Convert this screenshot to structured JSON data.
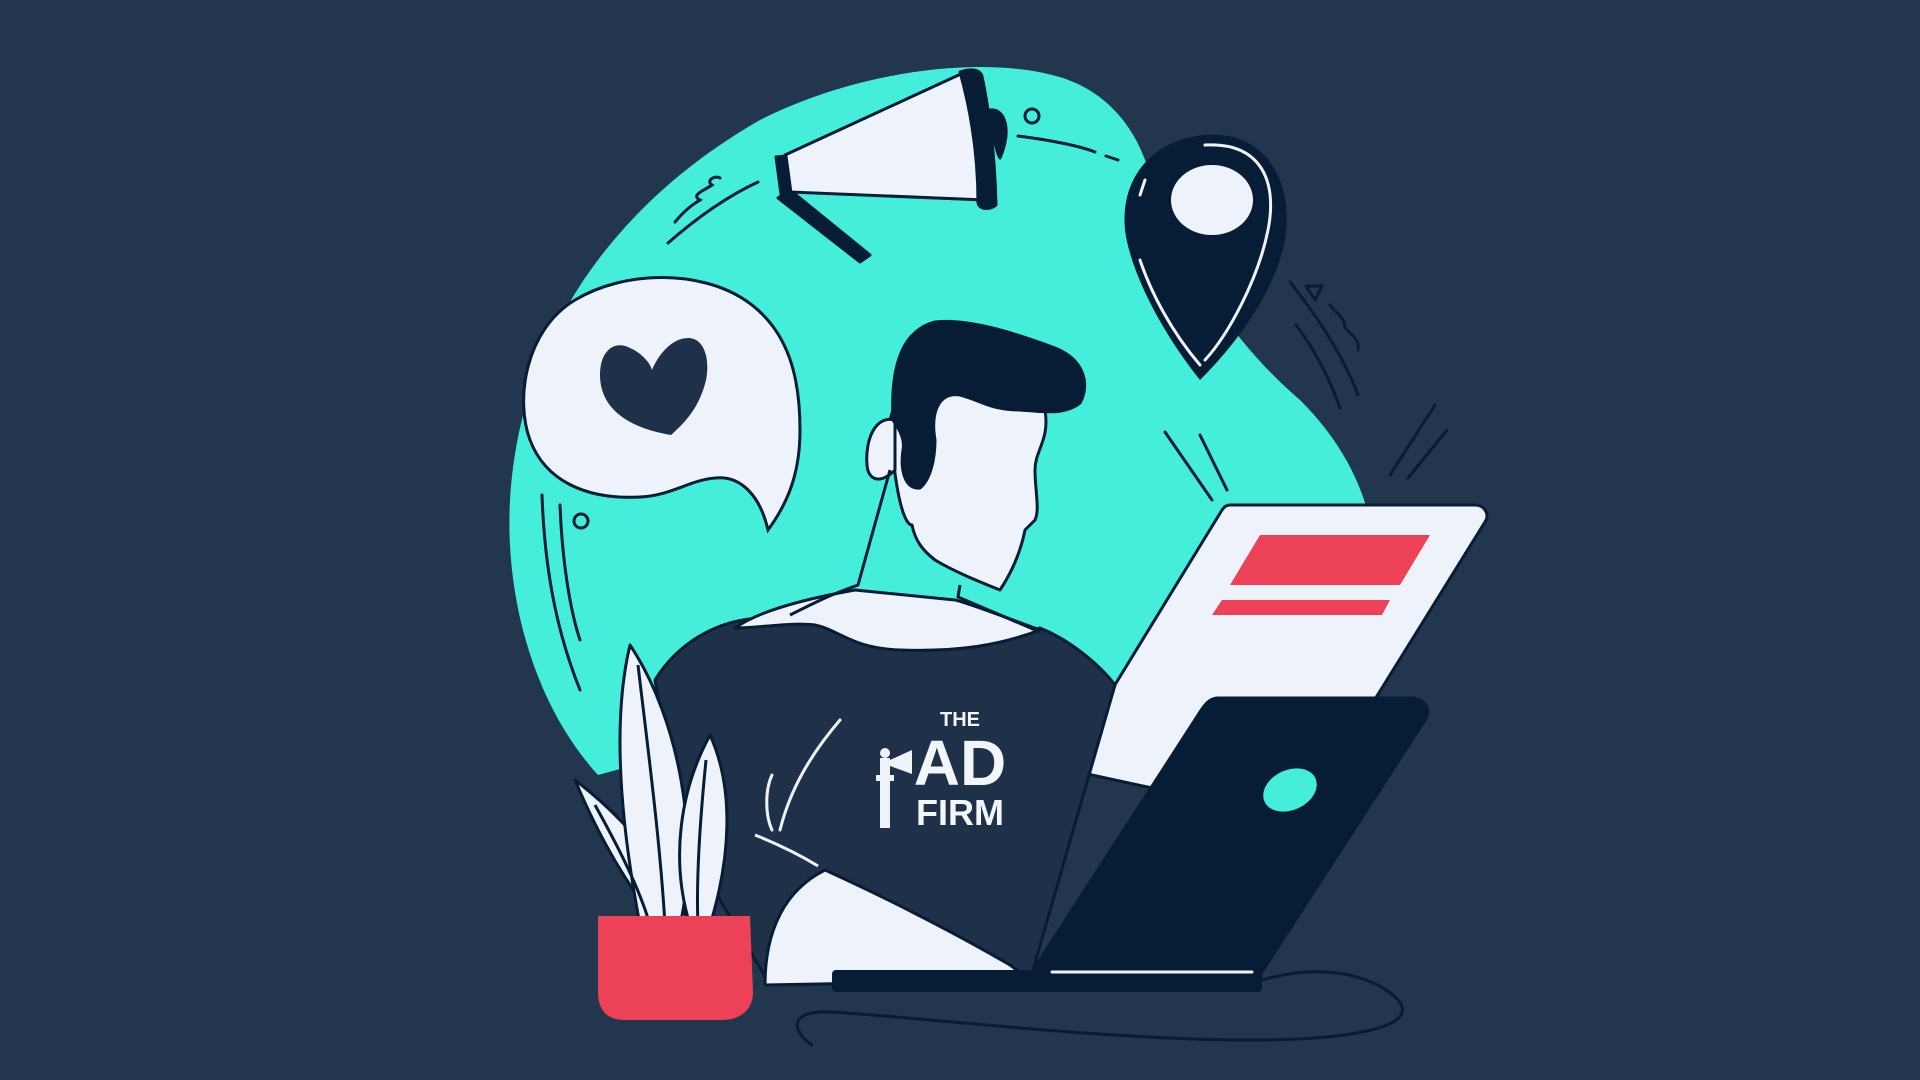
{
  "colors": {
    "background": "#22374d",
    "blob": "#44eedb",
    "navy": "#061d35",
    "shirt": "#1f3148",
    "white": "#eef3fb",
    "accent_red": "#ec4157"
  },
  "logo": {
    "line1": "THE",
    "line2": "AD",
    "line3": "FIRM"
  },
  "icons": [
    "megaphone-icon",
    "location-pin-icon",
    "heart-speech-bubble-icon",
    "laptop-icon",
    "plant-icon"
  ]
}
